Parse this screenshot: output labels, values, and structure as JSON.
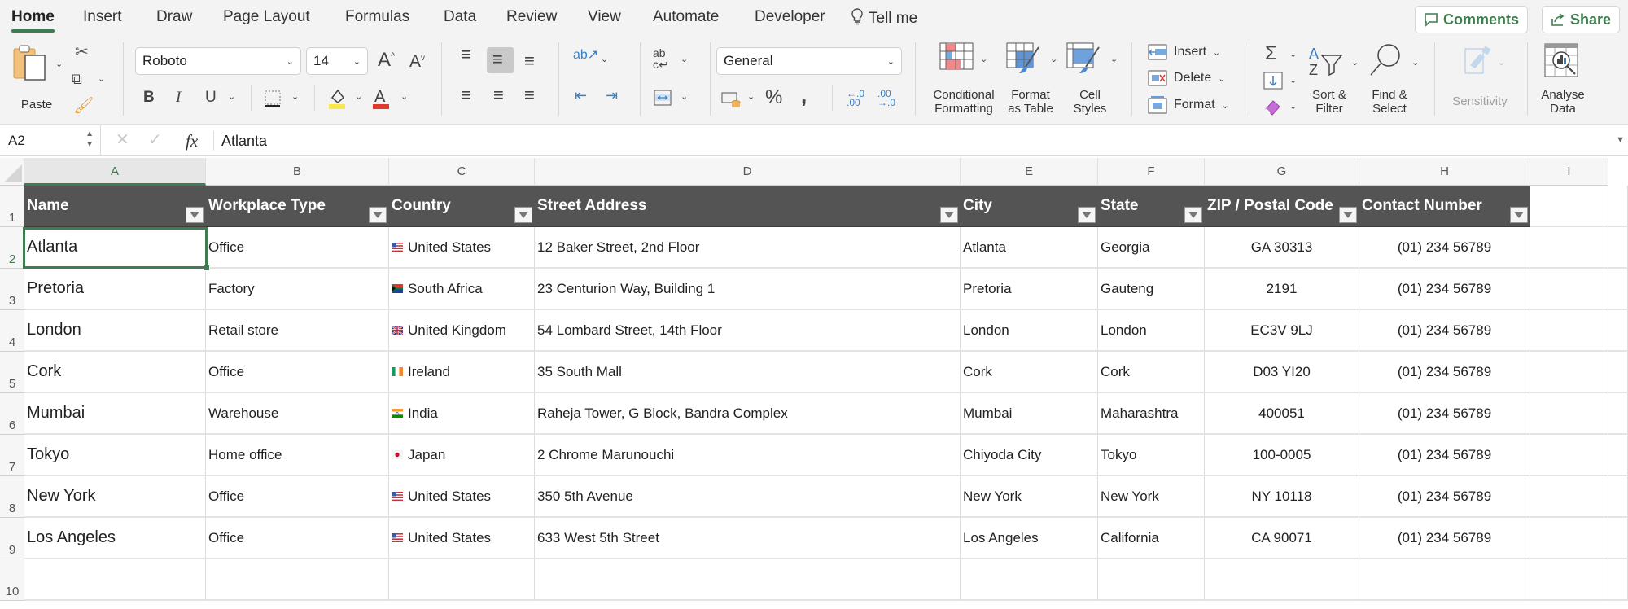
{
  "tabs": [
    "Home",
    "Insert",
    "Draw",
    "Page Layout",
    "Formulas",
    "Data",
    "Review",
    "View",
    "Automate",
    "Developer"
  ],
  "active_tab": "Home",
  "tell_me": "Tell me",
  "header_buttons": {
    "comments": "Comments",
    "share": "Share"
  },
  "ribbon": {
    "paste": "Paste",
    "font_name": "Roboto",
    "font_size": "14",
    "number_format": "General",
    "conditional_formatting": [
      "Conditional",
      "Formatting"
    ],
    "format_as_table": [
      "Format",
      "as Table"
    ],
    "cell_styles": [
      "Cell",
      "Styles"
    ],
    "insert": "Insert",
    "delete": "Delete",
    "format": "Format",
    "sort_filter": [
      "Sort &",
      "Filter"
    ],
    "find_select": [
      "Find &",
      "Select"
    ],
    "sensitivity": "Sensitivity",
    "analyse_data": [
      "Analyse",
      "Data"
    ],
    "colors": {
      "highlight": "#f7e94a",
      "font_color": "#e03a2e",
      "accent": "#3f7c4f"
    }
  },
  "formula_bar": {
    "cell_ref": "A2",
    "fx": "fx",
    "value": "Atlanta"
  },
  "columns": [
    "A",
    "B",
    "C",
    "D",
    "E",
    "F",
    "G",
    "H",
    "I"
  ],
  "rows": [
    "1",
    "2",
    "3",
    "4",
    "5",
    "6",
    "7",
    "8",
    "9",
    "10"
  ],
  "table": {
    "headers": [
      "Name",
      "Workplace Type",
      "Country",
      "Street Address",
      "City",
      "State",
      "ZIP / Postal Code",
      "Contact Number"
    ],
    "rows": [
      {
        "name": "Atlanta",
        "type": "Office",
        "flag": "us",
        "country": "United States",
        "street": "12 Baker Street, 2nd Floor",
        "city": "Atlanta",
        "state": "Georgia",
        "zip": "GA 30313",
        "phone": "(01) 234 56789"
      },
      {
        "name": "Pretoria",
        "type": "Factory",
        "flag": "za",
        "country": "South Africa",
        "street": "23 Centurion Way, Building 1",
        "city": "Pretoria",
        "state": "Gauteng",
        "zip": "2191",
        "phone": "(01) 234 56789"
      },
      {
        "name": "London",
        "type": "Retail store",
        "flag": "gb",
        "country": "United Kingdom",
        "street": "54 Lombard Street, 14th Floor",
        "city": "London",
        "state": "London",
        "zip": "EC3V 9LJ",
        "phone": "(01) 234 56789"
      },
      {
        "name": "Cork",
        "type": "Office",
        "flag": "ie",
        "country": "Ireland",
        "street": "35 South Mall",
        "city": "Cork",
        "state": "Cork",
        "zip": "D03 YI20",
        "phone": "(01) 234 56789"
      },
      {
        "name": "Mumbai",
        "type": "Warehouse",
        "flag": "in",
        "country": "India",
        "street": "Raheja Tower, G Block, Bandra Complex",
        "city": "Mumbai",
        "state": "Maharashtra",
        "zip": "400051",
        "phone": "(01) 234 56789"
      },
      {
        "name": "Tokyo",
        "type": "Home office",
        "flag": "jp",
        "country": "Japan",
        "street": "2 Chrome Marunouchi",
        "city": "Chiyoda City",
        "state": "Tokyo",
        "zip": "100-0005",
        "phone": "(01) 234 56789"
      },
      {
        "name": "New York",
        "type": "Office",
        "flag": "us",
        "country": "United States",
        "street": "350 5th Avenue",
        "city": "New York",
        "state": "New York",
        "zip": "NY 10118",
        "phone": "(01) 234 56789"
      },
      {
        "name": "Los Angeles",
        "type": "Office",
        "flag": "us",
        "country": "United States",
        "street": "633 West 5th Street",
        "city": "Los Angeles",
        "state": "California",
        "zip": "CA 90071",
        "phone": "(01) 234 56789"
      }
    ]
  }
}
